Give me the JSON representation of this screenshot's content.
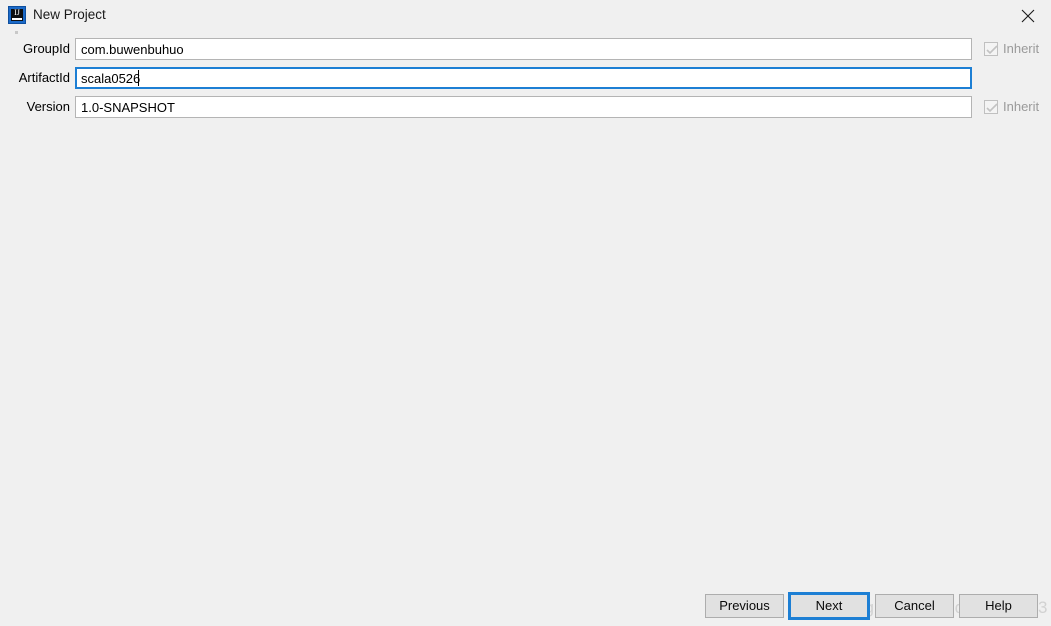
{
  "window": {
    "title": "New Project",
    "app_icon": "intellij-idea-icon",
    "close_icon": "close-icon",
    "background_color": "#f0f0f0"
  },
  "form": {
    "fields": [
      {
        "label": "GroupId",
        "value": "com.buwenbuhuo",
        "focused": false,
        "inherit": {
          "label": "Inherit",
          "checked": true,
          "enabled": false
        }
      },
      {
        "label": "ArtifactId",
        "value": "scala0526",
        "focused": true,
        "inherit": null
      },
      {
        "label": "Version",
        "value": "1.0-SNAPSHOT",
        "focused": false,
        "inherit": {
          "label": "Inherit",
          "checked": true,
          "enabled": false
        }
      }
    ]
  },
  "buttons": {
    "previous": "Previous",
    "next": "Next",
    "cancel": "Cancel",
    "help": "Help",
    "focus_color": "#1d7fd4"
  },
  "watermark": {
    "text": "https://blog.csdn.net/qq_16146103",
    "color": "#d2d2d2"
  }
}
